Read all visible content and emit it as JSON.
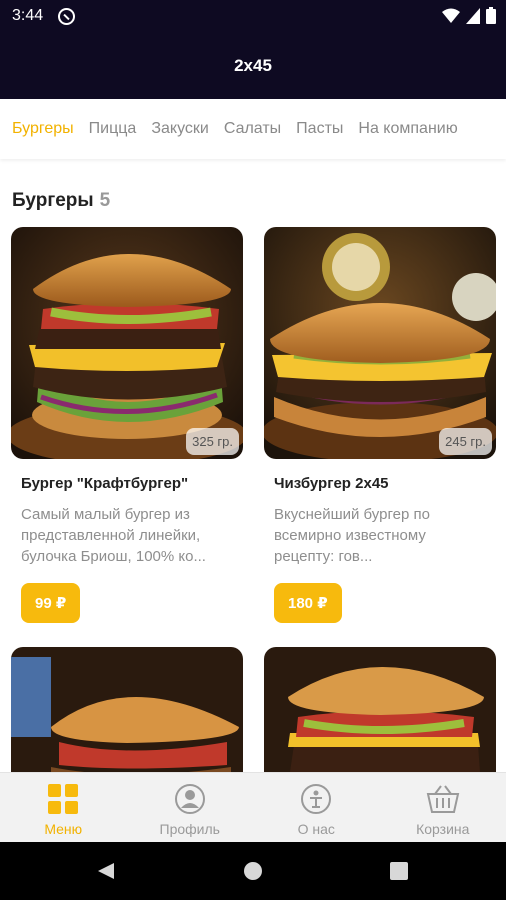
{
  "status_bar": {
    "time": "3:44"
  },
  "header": {
    "title": "2x45"
  },
  "tabs": [
    {
      "label": "Бургеры",
      "active": true
    },
    {
      "label": "Пицца",
      "active": false
    },
    {
      "label": "Закуски",
      "active": false
    },
    {
      "label": "Салаты",
      "active": false
    },
    {
      "label": "Пасты",
      "active": false
    },
    {
      "label": "На компанию",
      "active": false
    }
  ],
  "section": {
    "title": "Бургеры",
    "count": "5"
  },
  "products": [
    {
      "name": "Бургер \"Крафтбургер\"",
      "description": "Самый малый бургер из представленной линейки, булочка Бриош, 100% ко...",
      "weight": "325 гр.",
      "price": "99 ₽"
    },
    {
      "name": "Чизбургер 2х45",
      "description": "Вкуснейший бургер по всемирно известному рецепту: гов...",
      "weight": "245 гр.",
      "price": "180 ₽"
    }
  ],
  "bottom_nav": [
    {
      "label": "Меню",
      "icon": "grid-icon",
      "active": true
    },
    {
      "label": "Профиль",
      "icon": "profile-icon",
      "active": false
    },
    {
      "label": "О нас",
      "icon": "info-icon",
      "active": false
    },
    {
      "label": "Корзина",
      "icon": "basket-icon",
      "active": false
    }
  ],
  "colors": {
    "accent": "#f7ba0d",
    "header_bg": "#0e0a22"
  }
}
